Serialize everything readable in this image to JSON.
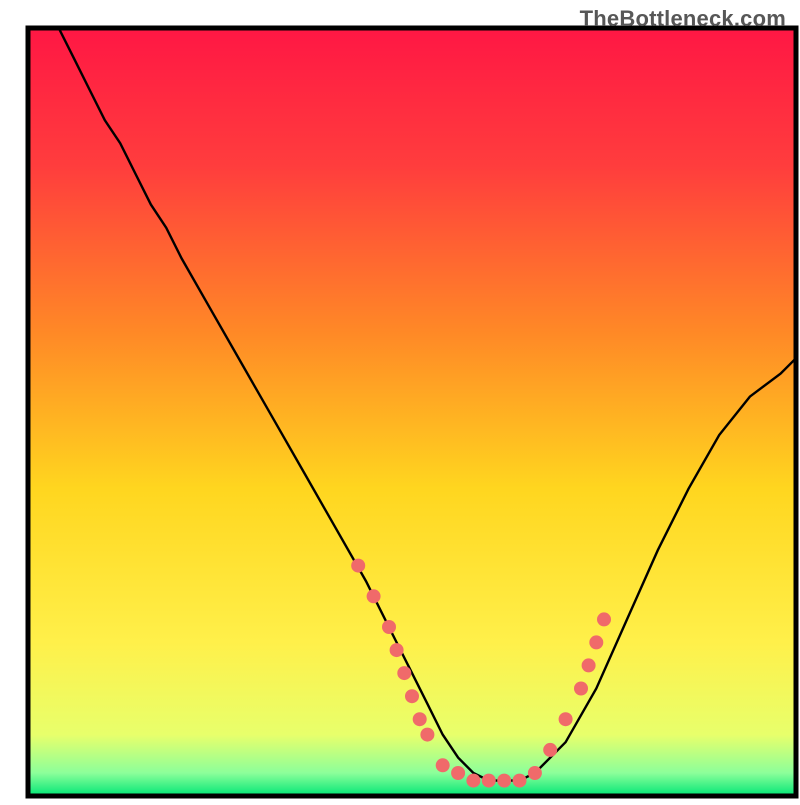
{
  "watermark": "TheBottleneck.com",
  "chart_data": {
    "type": "line",
    "title": "",
    "xlabel": "",
    "ylabel": "",
    "xlim": [
      0,
      100
    ],
    "ylim": [
      0,
      100
    ],
    "x": [
      4,
      6,
      8,
      10,
      12,
      14,
      16,
      18,
      20,
      24,
      28,
      32,
      36,
      40,
      44,
      48,
      50,
      52,
      54,
      56,
      58,
      60,
      62,
      64,
      66,
      70,
      74,
      78,
      82,
      86,
      90,
      94,
      98,
      100
    ],
    "values": [
      100,
      96,
      92,
      88,
      85,
      81,
      77,
      74,
      70,
      63,
      56,
      49,
      42,
      35,
      28,
      20,
      16,
      12,
      8,
      5,
      3,
      2,
      2,
      2,
      3,
      7,
      14,
      23,
      32,
      40,
      47,
      52,
      55,
      57
    ],
    "gradient_stops": [
      {
        "offset": 0.0,
        "color": "#ff1744"
      },
      {
        "offset": 0.18,
        "color": "#ff3d3d"
      },
      {
        "offset": 0.4,
        "color": "#ff8a26"
      },
      {
        "offset": 0.6,
        "color": "#ffd61f"
      },
      {
        "offset": 0.8,
        "color": "#fff04a"
      },
      {
        "offset": 0.92,
        "color": "#e8ff6b"
      },
      {
        "offset": 0.97,
        "color": "#8cff9a"
      },
      {
        "offset": 1.0,
        "color": "#00e676"
      }
    ],
    "markers": [
      {
        "x": 43,
        "y": 30
      },
      {
        "x": 45,
        "y": 26
      },
      {
        "x": 47,
        "y": 22
      },
      {
        "x": 48,
        "y": 19
      },
      {
        "x": 49,
        "y": 16
      },
      {
        "x": 50,
        "y": 13
      },
      {
        "x": 51,
        "y": 10
      },
      {
        "x": 52,
        "y": 8
      },
      {
        "x": 54,
        "y": 4
      },
      {
        "x": 56,
        "y": 3
      },
      {
        "x": 58,
        "y": 2
      },
      {
        "x": 60,
        "y": 2
      },
      {
        "x": 62,
        "y": 2
      },
      {
        "x": 64,
        "y": 2
      },
      {
        "x": 66,
        "y": 3
      },
      {
        "x": 68,
        "y": 6
      },
      {
        "x": 70,
        "y": 10
      },
      {
        "x": 72,
        "y": 14
      },
      {
        "x": 73,
        "y": 17
      },
      {
        "x": 74,
        "y": 20
      },
      {
        "x": 75,
        "y": 23
      }
    ],
    "marker_color": "#f06a6a",
    "line_color": "#000000",
    "frame_color": "#000000"
  }
}
